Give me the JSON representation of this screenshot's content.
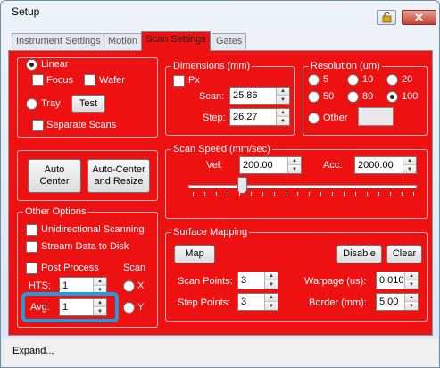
{
  "window": {
    "title": "Setup"
  },
  "tabs": [
    "Instrument Settings",
    "Motion",
    "Scan Settings",
    "Gates"
  ],
  "mode": {
    "linear": "Linear",
    "focus": "Focus",
    "wafer": "Wafer",
    "tray": "Tray",
    "test": "Test",
    "separate_scans": "Separate Scans"
  },
  "dimensions": {
    "title": "Dimensions (mm)",
    "px": "Px",
    "scan_label": "Scan:",
    "scan_value": "25.86",
    "step_label": "Step:",
    "step_value": "26.27"
  },
  "resolution": {
    "title": "Resolution (um)",
    "options": [
      "5",
      "10",
      "20",
      "50",
      "80",
      "100"
    ],
    "selected": "100",
    "other": "Other"
  },
  "center": {
    "auto_center": "Auto\nCenter",
    "auto_center_resize": "Auto-Center\nand Resize"
  },
  "scan_speed": {
    "title": "Scan Speed (mm/sec)",
    "vel_label": "Vel:",
    "vel_value": "200.00",
    "acc_label": "Acc:",
    "acc_value": "2000.00"
  },
  "other_options": {
    "title": "Other Options",
    "unidirectional": "Unidirectional Scanning",
    "stream": "Stream Data to Disk",
    "post_process": "Post Process",
    "scan_label": "Scan",
    "hts_label": "HTS:",
    "hts_value": "1",
    "avg_label": "Avg:",
    "avg_value": "1",
    "x_label": "X",
    "y_label": "Y"
  },
  "surface": {
    "title": "Surface Mapping",
    "map": "Map",
    "disable": "Disable",
    "clear": "Clear",
    "scan_points_label": "Scan Points:",
    "scan_points_value": "3",
    "step_points_label": "Step Points:",
    "step_points_value": "3",
    "warpage_label": "Warpage (us):",
    "warpage_value": "0.010",
    "border_label": "Border (mm):",
    "border_value": "5.00"
  },
  "status": {
    "text": "Expand..."
  },
  "colors": {
    "panel": "#ee1111",
    "highlight": "#1a9ee0"
  }
}
